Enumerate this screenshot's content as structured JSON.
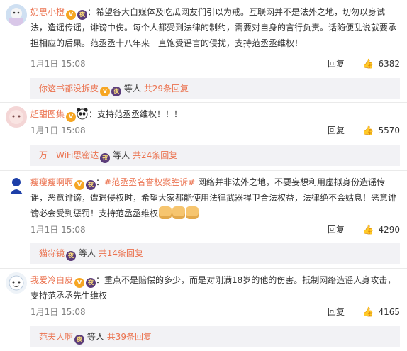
{
  "comments": [
    {
      "user": "奶思小橙",
      "text": "：希望各大自媒体及吃瓜网友们引以为戒。互联网并不是法外之地，切勿以身试法，造谣传谣，诽谤中伤。每个人都受到法律的制约，需要对自身的言行负责。话随便乱说就要承担相应的后果。范丞丞十八年来一直饱受谣言的侵扰，支持范丞丞维权！",
      "time": "1月1日 15:08",
      "reply": "回复",
      "likes": "6382",
      "sub_user": "你这书都没拆皮",
      "sub_mid": "等人",
      "sub_count": "共29条回复"
    },
    {
      "user": "超甜图集",
      "text": "：支持范丞丞维权！！！",
      "time": "1月1日 15:08",
      "reply": "回复",
      "likes": "5570",
      "sub_user": "万一WiFi思密达",
      "sub_mid": "等人",
      "sub_count": "共24条回复"
    },
    {
      "user": "瘦瘦瘦啊啊",
      "topic": "#范丞丞名誉权案胜诉#",
      "text": " 网络并非法外之地，不要妄想利用虚拟身份造谣传谣，恶意诽谤，遭遇侵权时，希望大家都能使用法律武器捍卫合法权益，法律绝不会姑息！恶意诽谤必会受到惩罚！支持范丞丞维权",
      "time": "1月1日 15:08",
      "reply": "回复",
      "likes": "4290",
      "sub_user": "猫尛镜",
      "sub_mid": "等人",
      "sub_count": "共14条回复"
    },
    {
      "user": "我爱冷白皮",
      "text": "：重点不是赔偿的多少，而是对刚满18岁的他的伤害。抵制网络造谣人身攻击，支持范丞丞先生维权",
      "time": "1月1日 15:08",
      "reply": "回复",
      "likes": "4165",
      "sub_user": "范夫人啊",
      "sub_mid": "等人",
      "sub_count": "共39条回复"
    }
  ],
  "icons": {
    "like": "thumbs-up-icon",
    "vip": "vip-badge-icon",
    "night": "night-badge-icon"
  },
  "colors": {
    "username": "#eb7350",
    "subbox": "#f2f2f5",
    "meta": "#808080"
  },
  "badge_text": {
    "night": "夜",
    "vip": "V"
  }
}
